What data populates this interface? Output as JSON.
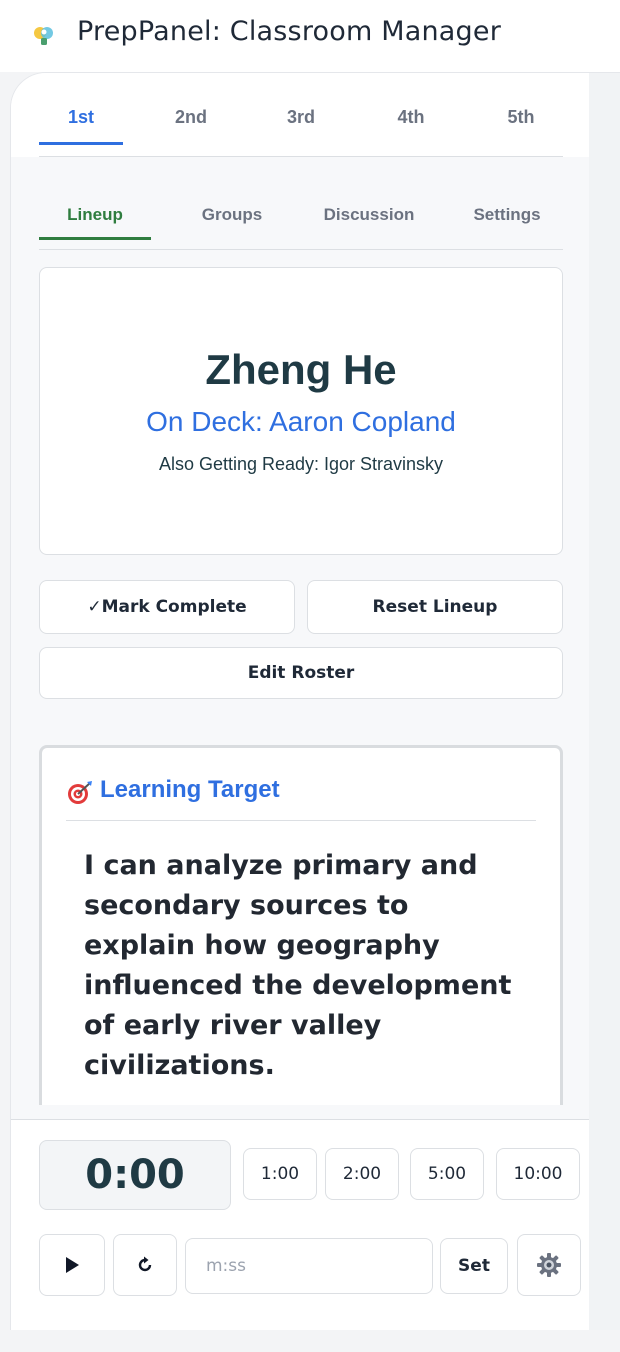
{
  "app": {
    "title": "PrepPanel: Classroom Manager"
  },
  "period_tabs": [
    {
      "label": "1st",
      "active": true
    },
    {
      "label": "2nd",
      "active": false
    },
    {
      "label": "3rd",
      "active": false
    },
    {
      "label": "4th",
      "active": false
    },
    {
      "label": "5th",
      "active": false
    }
  ],
  "sub_tabs": [
    {
      "label": "Lineup",
      "active": true
    },
    {
      "label": "Groups",
      "active": false
    },
    {
      "label": "Discussion",
      "active": false
    },
    {
      "label": "Settings",
      "active": false
    }
  ],
  "lineup": {
    "current": "Zheng He",
    "on_deck": "On Deck: Aaron Copland",
    "also_ready": "Also Getting Ready: Igor Stravinsky"
  },
  "actions": {
    "mark_complete": "✓Mark Complete",
    "reset_lineup": "Reset Lineup",
    "edit_roster": "Edit Roster"
  },
  "learning_target": {
    "title": "Learning Target",
    "text": "I can analyze primary and secondary sources to explain how geography influenced the development of early river valley civilizations."
  },
  "timer": {
    "display": "0:00",
    "presets": [
      "1:00",
      "2:00",
      "5:00",
      "10:00"
    ],
    "input_placeholder": "m:ss",
    "set_label": "Set",
    "play_icon": "play-icon",
    "reset_icon": "reset-icon",
    "settings_icon": "gear-icon"
  },
  "colors": {
    "accent_blue": "#2f6fe0",
    "accent_green": "#2f7d3f",
    "text_dark": "#1f3a44"
  }
}
